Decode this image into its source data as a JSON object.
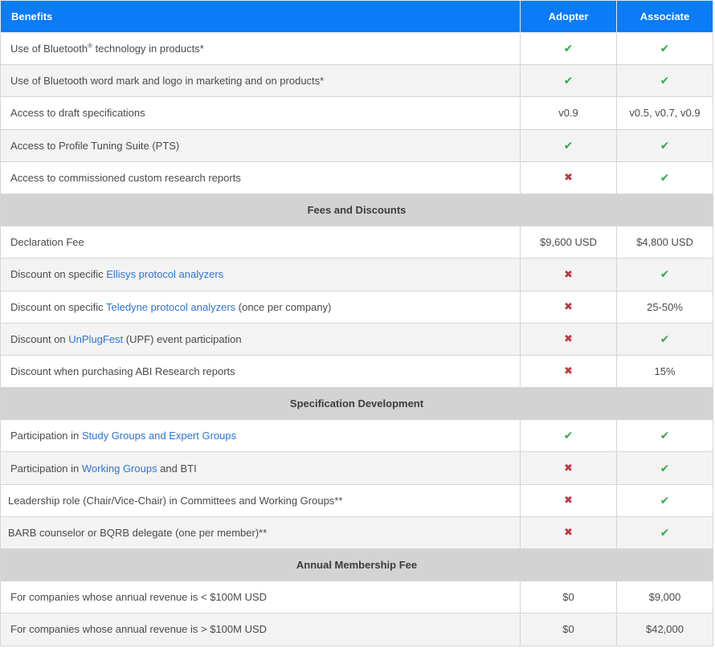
{
  "header": {
    "col_benefits": "Benefits",
    "col_adopter": "Adopter",
    "col_associate": "Associate"
  },
  "icons": {
    "check": "✔",
    "cross": "✖",
    "check_color": "#3aa84f",
    "cross_color": "#c0353f",
    "header_color": "#0b7cf5",
    "link_color": "#2f74d0"
  },
  "rows": {
    "bt_tech": {
      "pre": "Use of Bluetooth",
      "sup": "®",
      "post": " technology in products*",
      "adopter": "✔",
      "associate": "✔"
    },
    "wordmark": {
      "label": "Use of Bluetooth word mark and logo in marketing and on products*",
      "adopter": "✔",
      "associate": "✔"
    },
    "drafts": {
      "label": "Access to draft specifications",
      "adopter": "v0.9",
      "associate": "v0.5, v0.7, v0.9"
    },
    "pts": {
      "label": "Access to Profile Tuning Suite (PTS)",
      "adopter": "✔",
      "associate": "✔"
    },
    "research": {
      "label": "Access to commissioned custom research reports",
      "adopter": "✖",
      "associate": "✔"
    }
  },
  "fees": {
    "title": "Fees and Discounts",
    "declaration": {
      "label": "Declaration Fee",
      "adopter": "$9,600 USD",
      "associate": "$4,800 USD"
    },
    "ellisys": {
      "pre": "Discount on specific ",
      "link": "Ellisys protocol analyzers",
      "post": "",
      "adopter": "✖",
      "associate": "✔"
    },
    "teledyne": {
      "pre": "Discount on specific ",
      "link": "Teledyne protocol analyzers",
      "post": " (once per company)",
      "adopter": "✖",
      "associate": "25-50%"
    },
    "unplugfest": {
      "pre": "Discount on ",
      "link": "UnPlugFest",
      "post": " (UPF) event participation",
      "adopter": "✖",
      "associate": "✔"
    },
    "abi": {
      "label": "Discount when purchasing ABI Research reports",
      "adopter": "✖",
      "associate": "15%"
    }
  },
  "spec": {
    "title": "Specification Development",
    "study": {
      "pre": "Participation in ",
      "link": "Study Groups and Expert Groups",
      "post": "",
      "adopter": "✔",
      "associate": "✔"
    },
    "working": {
      "pre": "Participation in ",
      "link": "Working Groups",
      "post": " and BTI",
      "adopter": "✖",
      "associate": "✔"
    },
    "leadership": {
      "label": "Leadership role (Chair/Vice-Chair) in Committees and Working Groups**",
      "adopter": "✖",
      "associate": "✔"
    },
    "barb": {
      "label": "BARB counselor or BQRB delegate (one per member)**",
      "adopter": "✖",
      "associate": "✔"
    }
  },
  "annual": {
    "title": "Annual Membership Fee",
    "under": {
      "label": "For companies whose annual revenue is < $100M USD",
      "adopter": "$0",
      "associate": "$9,000"
    },
    "over": {
      "label": "For companies whose annual revenue is > $100M USD",
      "adopter": "$0",
      "associate": "$42,000"
    }
  }
}
